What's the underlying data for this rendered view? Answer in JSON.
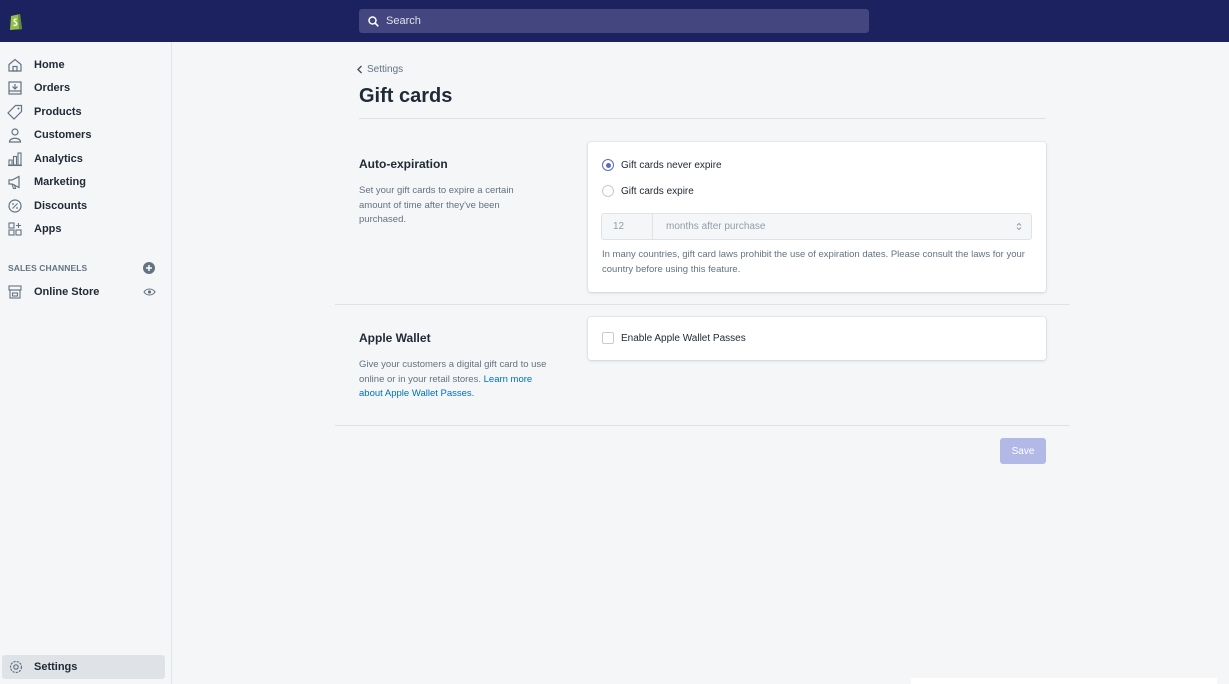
{
  "search": {
    "placeholder": "Search"
  },
  "sidebar": {
    "items": [
      {
        "label": "Home",
        "icon": "home-icon"
      },
      {
        "label": "Orders",
        "icon": "orders-icon"
      },
      {
        "label": "Products",
        "icon": "tag-icon"
      },
      {
        "label": "Customers",
        "icon": "person-icon"
      },
      {
        "label": "Analytics",
        "icon": "bar-chart-icon"
      },
      {
        "label": "Marketing",
        "icon": "megaphone-icon"
      },
      {
        "label": "Discounts",
        "icon": "discount-icon"
      },
      {
        "label": "Apps",
        "icon": "apps-icon"
      }
    ],
    "sales_channels_title": "SALES CHANNELS",
    "online_store_label": "Online Store",
    "settings_label": "Settings"
  },
  "breadcrumb": {
    "label": "Settings"
  },
  "page": {
    "title": "Gift cards"
  },
  "auto_expiration": {
    "title": "Auto-expiration",
    "description": "Set your gift cards to expire a certain amount of time after they've been purchased.",
    "option_never": "Gift cards never expire",
    "option_expire": "Gift cards expire",
    "selected": "never",
    "months_value": "12",
    "period_select": "months after purchase",
    "note": "In many countries, gift card laws prohibit the use of expiration dates. Please consult the laws for your country before using this feature."
  },
  "apple_wallet": {
    "title": "Apple Wallet",
    "description": "Give your customers a digital gift card to use online or in your retail stores.",
    "link_text": "Learn more about Apple Wallet Passes.",
    "checkbox_label": "Enable Apple Wallet Passes",
    "checked": false
  },
  "actions": {
    "save_label": "Save"
  },
  "colors": {
    "topbar": "#1c2260",
    "accent": "#5c6ac4",
    "link": "#006fbb",
    "save_disabled": "#b3b9e6"
  }
}
